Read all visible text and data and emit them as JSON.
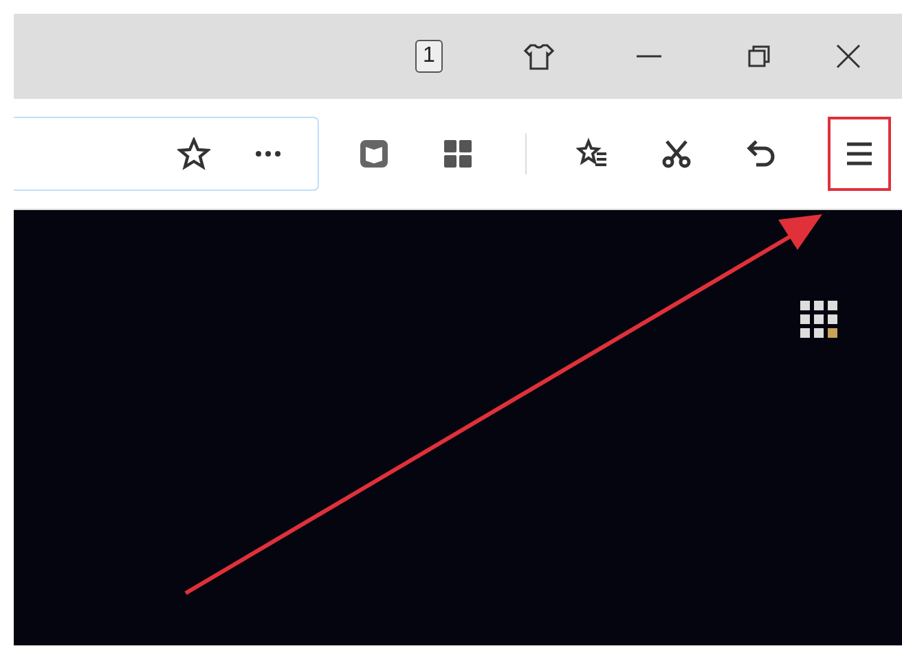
{
  "title_bar": {
    "tab_counter": "1"
  }
}
